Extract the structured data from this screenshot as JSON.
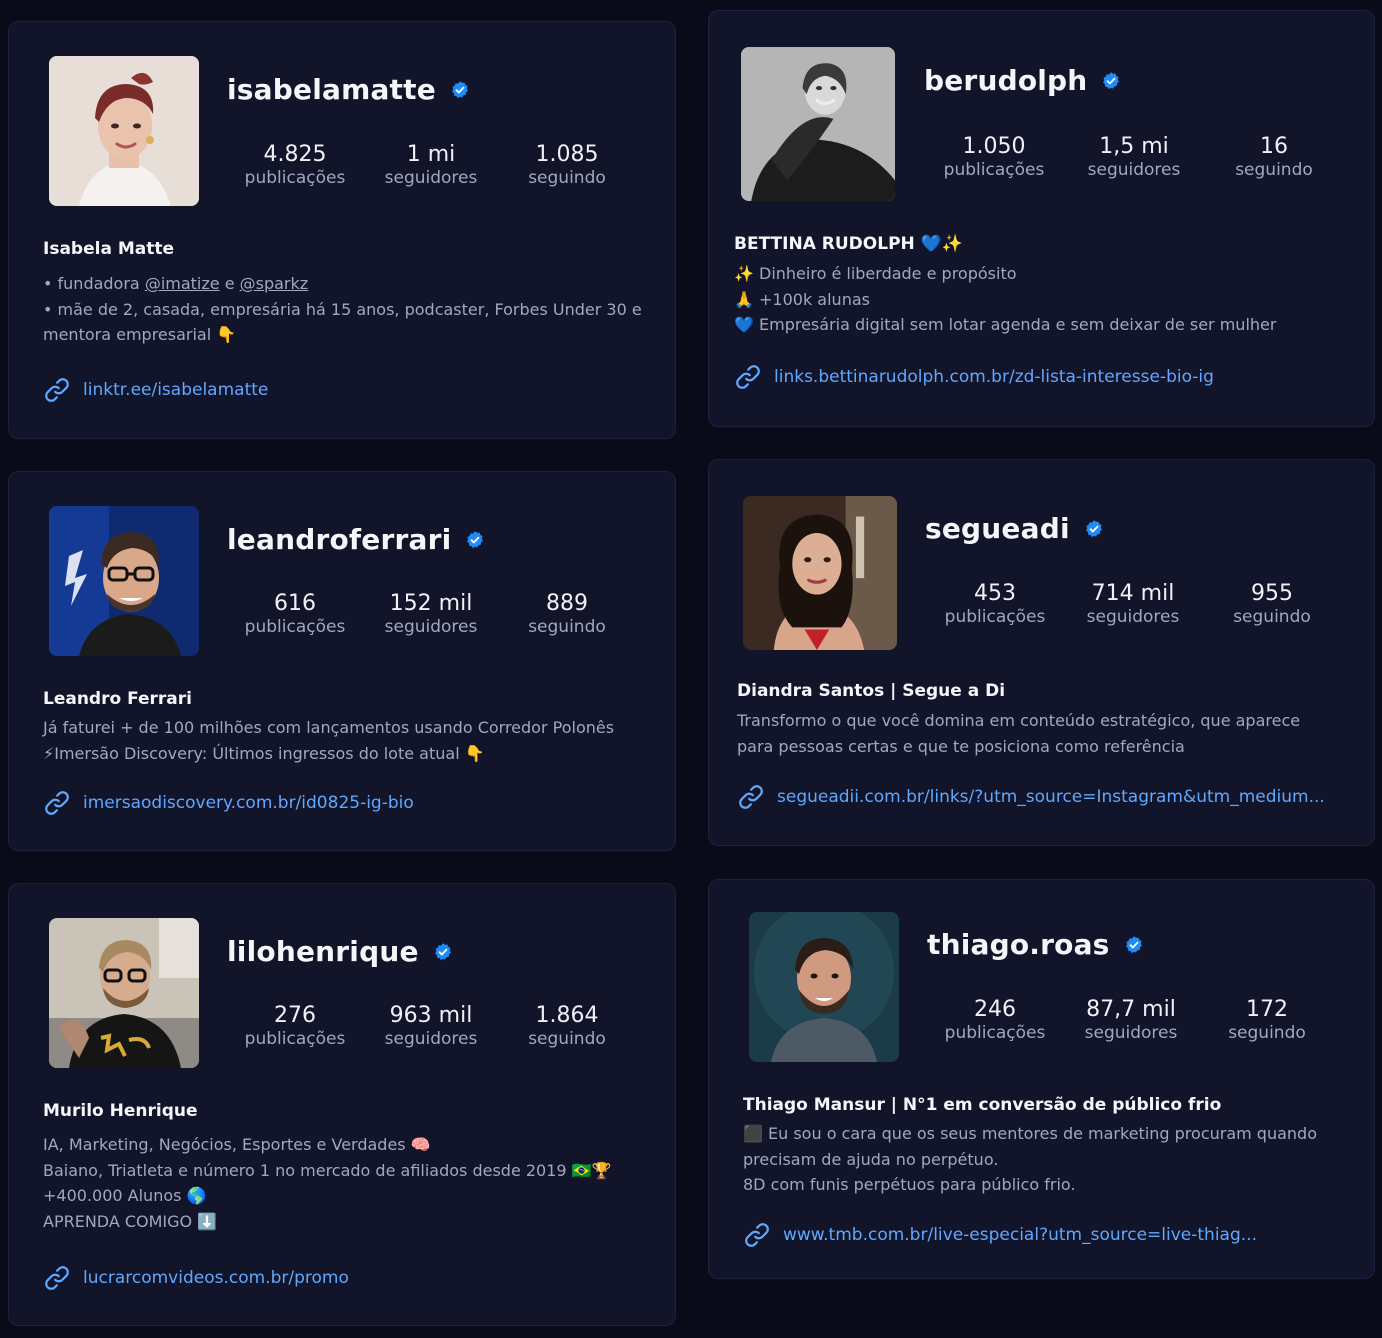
{
  "profiles": [
    {
      "username": "isabelamatte",
      "stats": [
        {
          "value": "4.825",
          "label": "publicações"
        },
        {
          "value": "1 mi",
          "label": "seguidores"
        },
        {
          "value": "1.085",
          "label": "seguindo"
        }
      ],
      "full_name": "Isabela Matte",
      "bio": {
        "l1_prefix": "• fundadora ",
        "l1_m1": "@imatize",
        "l1_mid": " e ",
        "l1_m2": "@sparkz",
        "l2": "• mãe de 2, casada, empresária há 15 anos, podcaster, Forbes Under 30 e",
        "l3": "mentora empresarial 👇"
      },
      "link": "linktr.ee/isabelamatte"
    },
    {
      "username": "berudolph",
      "stats": [
        {
          "value": "1.050",
          "label": "publicações"
        },
        {
          "value": "1,5 mi",
          "label": "seguidores"
        },
        {
          "value": "16",
          "label": "seguindo"
        }
      ],
      "full_name": "BETTINA RUDOLPH 💙✨",
      "bio": {
        "l1": "✨ Dinheiro é liberdade e propósito",
        "l2": "🙏 +100k alunas",
        "l3": "💙 Empresária digital sem lotar agenda e sem deixar de ser mulher"
      },
      "link": "links.bettinarudolph.com.br/zd-lista-interesse-bio-ig"
    },
    {
      "username": "leandroferrari",
      "stats": [
        {
          "value": "616",
          "label": "publicações"
        },
        {
          "value": "152 mil",
          "label": "seguidores"
        },
        {
          "value": "889",
          "label": "seguindo"
        }
      ],
      "full_name": "Leandro Ferrari",
      "bio": {
        "l1": "Já faturei + de 100 milhões com lançamentos usando Corredor Polonês",
        "l2": "⚡Imersão Discovery: Últimos ingressos do lote atual 👇"
      },
      "link": "imersaodiscovery.com.br/id0825-ig-bio"
    },
    {
      "username": "segueadi",
      "stats": [
        {
          "value": "453",
          "label": "publicações"
        },
        {
          "value": "714 mil",
          "label": "seguidores"
        },
        {
          "value": "955",
          "label": "seguindo"
        }
      ],
      "full_name": "Diandra Santos | Segue a Di",
      "bio": {
        "l1": "Transformo o que você domina em conteúdo estratégico, que aparece",
        "l2": "para pessoas certas e que te posiciona como referência"
      },
      "link": "segueadii.com.br/links/?utm_source=Instagram&utm_medium..."
    },
    {
      "username": "lilohenrique",
      "stats": [
        {
          "value": "276",
          "label": "publicações"
        },
        {
          "value": "963 mil",
          "label": "seguidores"
        },
        {
          "value": "1.864",
          "label": "seguindo"
        }
      ],
      "full_name": "Murilo Henrique",
      "bio": {
        "l1": "IA, Marketing, Negócios, Esportes e Verdades 🧠",
        "l2": "Baiano, Triatleta e número 1 no mercado de afiliados desde 2019 🇧🇷🏆",
        "l3": "+400.000 Alunos 🌎",
        "l4": "APRENDA COMIGO ⬇️"
      },
      "link": "lucrarcomvideos.com.br/promo"
    },
    {
      "username": "thiago.roas",
      "stats": [
        {
          "value": "246",
          "label": "publicações"
        },
        {
          "value": "87,7 mil",
          "label": "seguidores"
        },
        {
          "value": "172",
          "label": "seguindo"
        }
      ],
      "full_name": "Thiago Mansur | N°1 em conversão de público frio",
      "bio": {
        "l1": "⬛ Eu sou o cara que os seus mentores de marketing procuram quando",
        "l2": "precisam de ajuda no perpétuo.",
        "l3": "8D com funis perpétuos para público frio."
      },
      "link": "www.tmb.com.br/live-especial?utm_source=live-thiag..."
    }
  ],
  "colors": {
    "page_bg": "#0a0a19",
    "card_bg": "#12142a",
    "link": "#5fa8ff",
    "verified": "#1d8cf8",
    "muted_text": "#a3a7bd"
  },
  "icons": {
    "verified": "verified-badge-icon",
    "link": "link-chain-icon"
  }
}
